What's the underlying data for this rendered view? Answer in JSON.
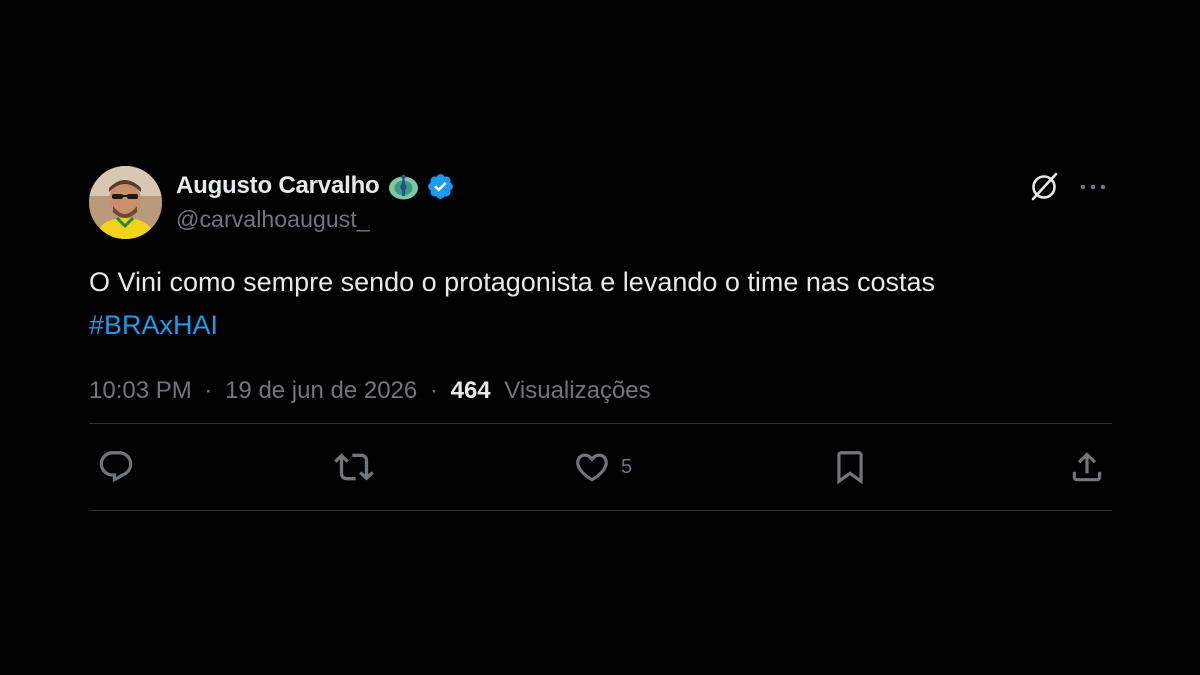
{
  "tweet": {
    "author": {
      "display_name": "Augusto Carvalho",
      "handle": "@carvalhoaugust_",
      "verified": true,
      "badge_emoji": "peacock-emoji"
    },
    "text": "O Vini como sempre sendo o protagonista e levando o time nas costas",
    "hashtag": "#BRAxHAI",
    "time": "10:03 PM",
    "date": "19 de jun de 2026",
    "separator": "·",
    "views_count": "464",
    "views_label": "Visualizações",
    "likes": "5"
  },
  "icons": {
    "grok": "grok-icon",
    "more": "more-icon",
    "reply": "reply-icon",
    "repost": "repost-icon",
    "like": "heart-icon",
    "bookmark": "bookmark-icon",
    "share": "share-icon",
    "verified": "verified-badge-icon"
  },
  "colors": {
    "background": "#000000",
    "text": "#e7e9ea",
    "secondary": "#71767b",
    "accent": "#1d9bf0",
    "divider": "#2f3336"
  }
}
